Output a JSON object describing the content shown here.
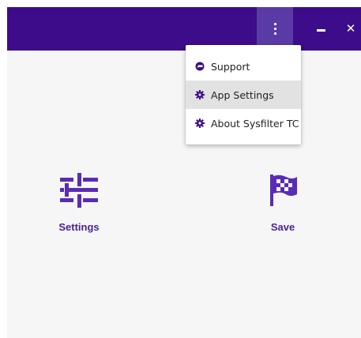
{
  "titlebar": {
    "background": "#3c0c8a",
    "menu_button_icon": "kebab-menu-icon",
    "minimize_icon": "minimize-icon",
    "close_glyph": "✕"
  },
  "dropdown": {
    "items": [
      {
        "label": "Support",
        "icon": "help-bubble-icon",
        "active": false
      },
      {
        "label": "App Settings",
        "icon": "gear-icon",
        "active": true
      },
      {
        "label": "About Sysfilter TC",
        "icon": "gear-icon",
        "active": false
      }
    ]
  },
  "main": {
    "tiles": [
      {
        "label": "Settings",
        "icon": "sliders-icon"
      },
      {
        "label": "Save",
        "icon": "checkered-flag-icon"
      }
    ],
    "accent": "#5a2bb5"
  }
}
